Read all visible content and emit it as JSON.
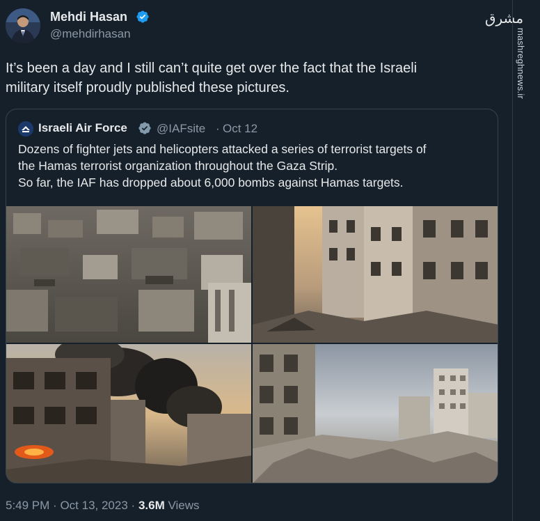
{
  "author": {
    "name": "Mehdi Hasan",
    "handle": "@mehdirhasan"
  },
  "watermark": {
    "logo_text": "مشرق",
    "site": "mashreghnews.ir"
  },
  "tweet": {
    "text_line1": "It’s been a day and I still can’t quite get over the fact that the Israeli",
    "text_line2": "military itself proudly published these pictures."
  },
  "quoted": {
    "name": "Israeli Air Force",
    "handle": "@IAFsite",
    "separator": "·",
    "date": "Oct 12",
    "line1": "Dozens of fighter jets and helicopters attacked a series of terrorist targets of",
    "line2": "the Hamas terrorist organization throughout the Gaza Strip.",
    "line3": "So far, the IAF has dropped about 6,000 bombs against Hamas targets."
  },
  "meta": {
    "time": "5:49 PM",
    "dot1": "·",
    "date": "Oct 13, 2023",
    "dot2": "·",
    "views_count": "3.6M",
    "views_label": "Views"
  },
  "colors": {
    "background": "#15202b",
    "text": "#e7e9ea",
    "muted": "#8b98a5",
    "verified": "#1d9bf0",
    "border": "#38444d"
  },
  "icons": {
    "verified": "verified-badge-icon"
  }
}
